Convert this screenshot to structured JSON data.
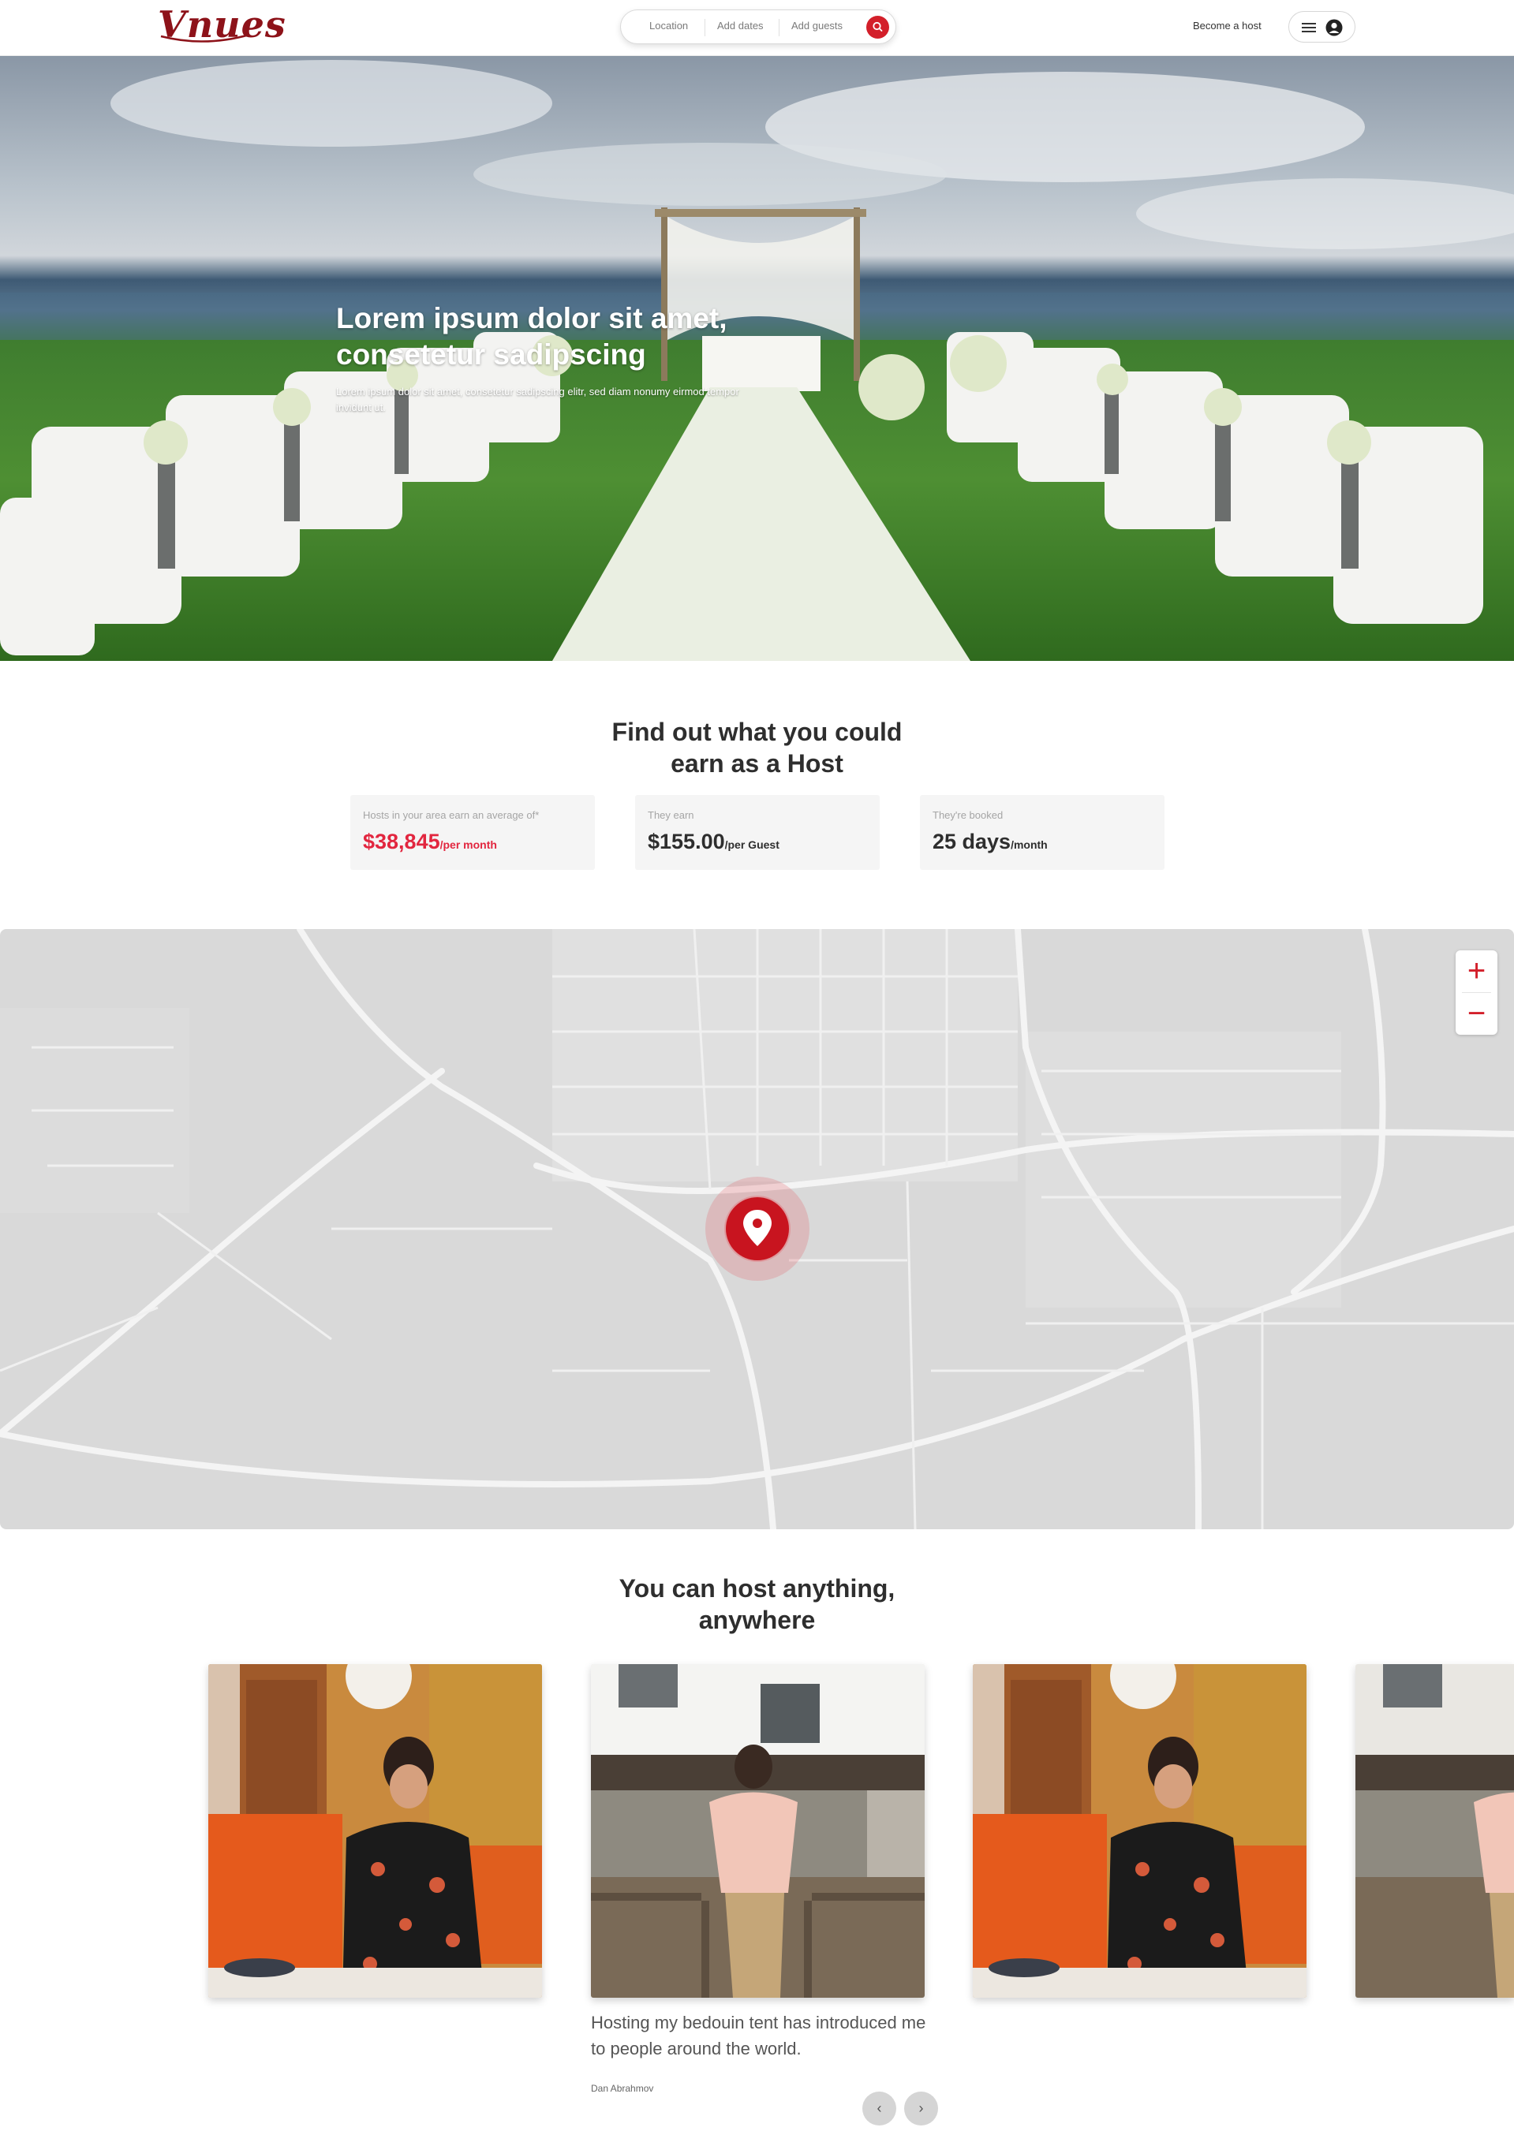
{
  "header": {
    "logo": "Vnues",
    "search": {
      "location": "Location",
      "dates": "Add dates",
      "guests": "Add guests"
    },
    "become_host": "Become a host"
  },
  "hero": {
    "title": "Lorem ipsum dolor sit amet, consetetur sadipscing",
    "subtitle": "Lorem ipsum dolor sit amet, consetetur sadipscing elitr, sed diam nonumy eirmod tempor invidunt ut."
  },
  "earn": {
    "title_line1": "Find out what you could",
    "title_line2": "earn as a Host",
    "stats": [
      {
        "label": "Hosts in your area earn an average of*",
        "value": "$38,845",
        "unit": "/per month"
      },
      {
        "label": "They earn",
        "value": "$155.00",
        "unit": "/per Guest"
      },
      {
        "label": "They're booked",
        "value": "25 days",
        "unit": "/month"
      }
    ]
  },
  "map": {
    "zoom_in": "+",
    "zoom_out": "−"
  },
  "host_anything": {
    "title_line1": "You can host anything,",
    "title_line2": "anywhere",
    "quote": "Hosting my bedouin tent has introduced me to people around the world.",
    "author": "Dan Abrahmov",
    "prev": "‹",
    "next": "›"
  },
  "colors": {
    "brand": "#8d1219",
    "accent": "#d31f2a",
    "stat_highlight": "#e2263f"
  }
}
